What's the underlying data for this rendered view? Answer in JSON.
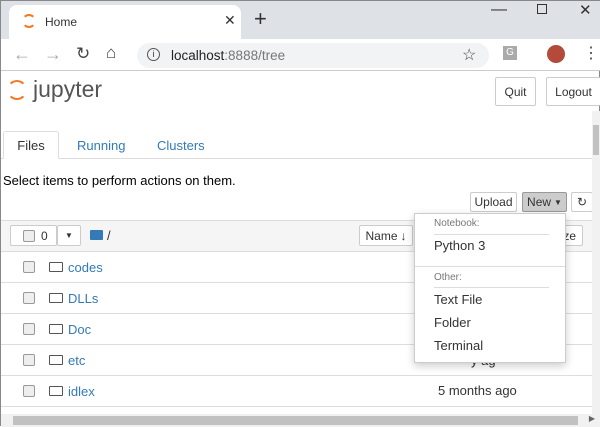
{
  "browser": {
    "tab_title": "Home",
    "url_host": "localhost",
    "url_rest": ":8888/tree",
    "extension_letter": "G"
  },
  "header": {
    "logo_text": "jupyter",
    "quit": "Quit",
    "logout": "Logout"
  },
  "tabs": [
    {
      "label": "Files"
    },
    {
      "label": "Running"
    },
    {
      "label": "Clusters"
    }
  ],
  "instructions": "Select items to perform actions on them.",
  "toolbar": {
    "upload": "Upload",
    "new": "New",
    "selected_count": "0",
    "path": "/"
  },
  "columns": {
    "name": "Name",
    "size_partial": "ze"
  },
  "files": [
    {
      "name": "codes",
      "modified": ""
    },
    {
      "name": "DLLs",
      "modified": ""
    },
    {
      "name": "Doc",
      "modified": ""
    },
    {
      "name": "etc",
      "modified": "y ag"
    },
    {
      "name": "idlex",
      "modified": "5 months ago"
    }
  ],
  "new_menu": {
    "notebook_header": "Notebook:",
    "python": "Python 3",
    "other_header": "Other:",
    "text_file": "Text File",
    "folder": "Folder",
    "terminal": "Terminal"
  },
  "colors": {
    "accent": "#f37726",
    "link": "#337ab7"
  }
}
